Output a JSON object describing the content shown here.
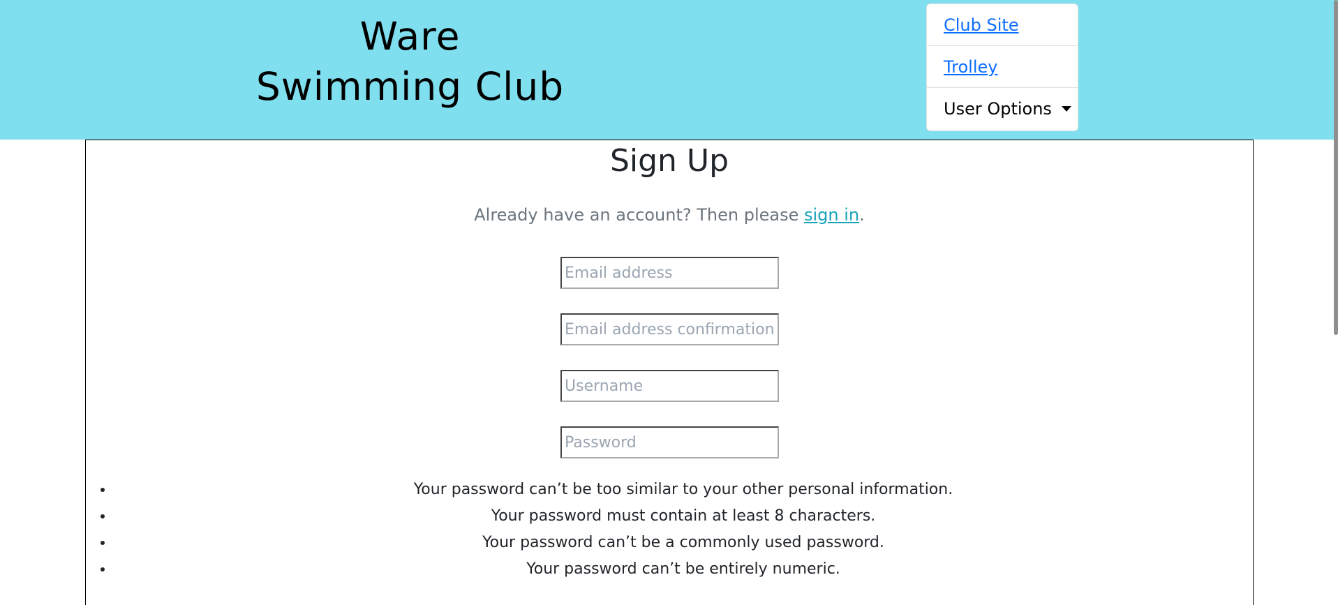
{
  "header": {
    "brand_line1": "Ware",
    "brand_line2": "Swimming Club",
    "nav": {
      "club_site": "Club Site",
      "trolley": "Trolley",
      "user_options": "User Options"
    }
  },
  "main": {
    "title": "Sign Up",
    "signin_prompt": "Already have an account? Then please ",
    "signin_link": "sign in",
    "signin_suffix": ".",
    "fields": {
      "email_placeholder": "Email address",
      "email_confirm_placeholder": "Email address confirmation",
      "username_placeholder": "Username",
      "password_placeholder": "Password"
    },
    "password_help": [
      "Your password can’t be too similar to your other personal information.",
      "Your password must contain at least 8 characters.",
      "Your password can’t be a commonly used password.",
      "Your password can’t be entirely numeric."
    ]
  },
  "colors": {
    "header_bg": "#7fdfee",
    "link": "#0d6efd",
    "signin_link": "#17a2b8",
    "muted_text": "#6c757d"
  },
  "icons": {
    "dropdown": "caret-down-icon"
  }
}
